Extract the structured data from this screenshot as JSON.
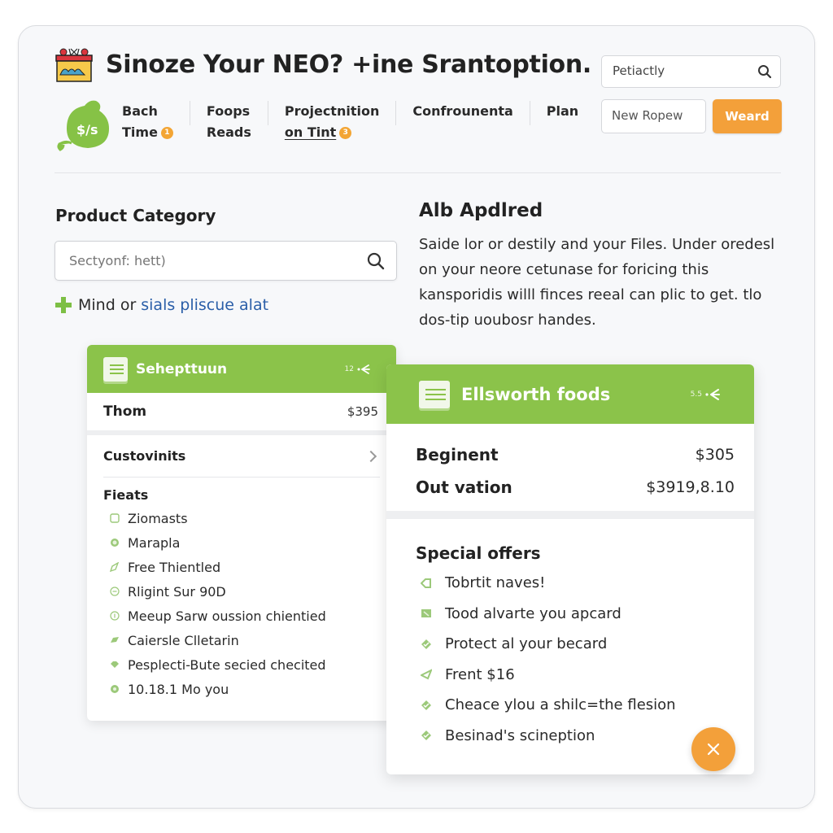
{
  "header": {
    "title": "Sinoze Your NEO? +ine Srantoption.",
    "nav": [
      {
        "line1": "Bach",
        "line2": "Time",
        "badge": "1"
      },
      {
        "line1": "Foops",
        "line2": "Reads",
        "badge": null
      },
      {
        "line1": "Projectnition",
        "line2": "on Tint",
        "badge": "3"
      },
      {
        "line1": "Confrounenta",
        "line2": "",
        "badge": null
      },
      {
        "line1": "Plan",
        "line2": "",
        "badge": null
      }
    ],
    "brand_badge_text": "$/s",
    "search_value": "Petiactly",
    "new_field_value": "New Ropew",
    "action_button": "Weard"
  },
  "category": {
    "title": "Product Category",
    "search_placeholder": "Sectyonf: hett)",
    "add_text": "Mind or",
    "add_link": "sials pliscue alat"
  },
  "info": {
    "title": "Alb Apdlred",
    "body": "Saide lor or destily and your Files. Under oredesl on your neore cetunase for foricing this kansporidis willl finces reeal can plic to get. tlo dos-tip uoubosr handes."
  },
  "card1": {
    "title": "Sehepttuun",
    "meta": "12",
    "price_label": "Thom",
    "price_value": "$395",
    "customize_label": "Custovinits",
    "features_title": "Fieats",
    "features": [
      {
        "icon": "square-icon",
        "text": "Ziomasts"
      },
      {
        "icon": "target-icon",
        "text": "Marapla"
      },
      {
        "icon": "tag-icon",
        "text": "Free Thientled"
      },
      {
        "icon": "minus-circle-icon",
        "text": "Rligint Sur 90D"
      },
      {
        "icon": "info-circle-icon",
        "text": "Meeup Sarw oussion chientied"
      },
      {
        "icon": "tag-icon",
        "text": "Caiersle Clletarin"
      },
      {
        "icon": "diamond-icon",
        "text": "Pesplecti-Bute secied checited"
      },
      {
        "icon": "circle-icon",
        "text": "10.18.1 Mo you"
      }
    ]
  },
  "card2": {
    "title": "Ellsworth foods",
    "meta": "5.5",
    "rows": [
      {
        "label": "Beginent",
        "value": "$305"
      },
      {
        "label": "Out vation",
        "value": "$3919,8.10"
      }
    ],
    "offers_title": "Special offers",
    "offers": [
      {
        "icon": "tag-icon",
        "text": "Tobrtit naves!"
      },
      {
        "icon": "card-icon",
        "text": "Tood alvarte you apcard"
      },
      {
        "icon": "check-tag-icon",
        "text": "Protect al your becard"
      },
      {
        "icon": "send-icon",
        "text": "Frent $16"
      },
      {
        "icon": "check-tag-icon",
        "text": "Cheace ylou a shilc=the flesion"
      },
      {
        "icon": "check-tag-icon",
        "text": "Besinad's scineption"
      }
    ]
  },
  "colors": {
    "accent_green": "#8bc34a",
    "accent_orange": "#f3a03a",
    "link_blue": "#2a5ea8"
  }
}
